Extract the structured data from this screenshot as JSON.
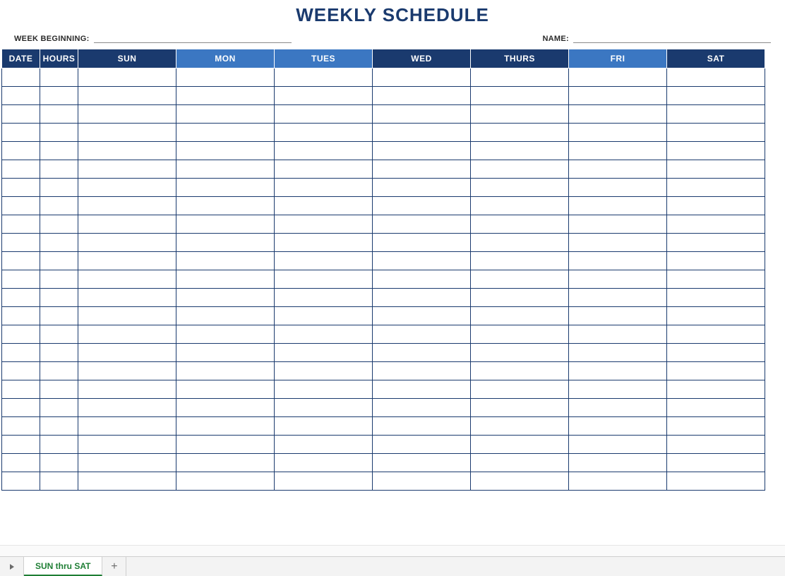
{
  "title": "WEEKLY SCHEDULE",
  "meta": {
    "week_label": "WEEK BEGINNING:",
    "week_value": "",
    "name_label": "NAME:",
    "name_value": ""
  },
  "columns": [
    {
      "label": "DATE",
      "style": "dark"
    },
    {
      "label": "HOURS",
      "style": "dark"
    },
    {
      "label": "SUN",
      "style": "dark"
    },
    {
      "label": "MON",
      "style": "light"
    },
    {
      "label": "TUES",
      "style": "light"
    },
    {
      "label": "WED",
      "style": "dark"
    },
    {
      "label": "THURS",
      "style": "dark"
    },
    {
      "label": "FRI",
      "style": "light"
    },
    {
      "label": "SAT",
      "style": "dark"
    }
  ],
  "row_count": 23,
  "tabs": {
    "active": "SUN thru SAT"
  }
}
